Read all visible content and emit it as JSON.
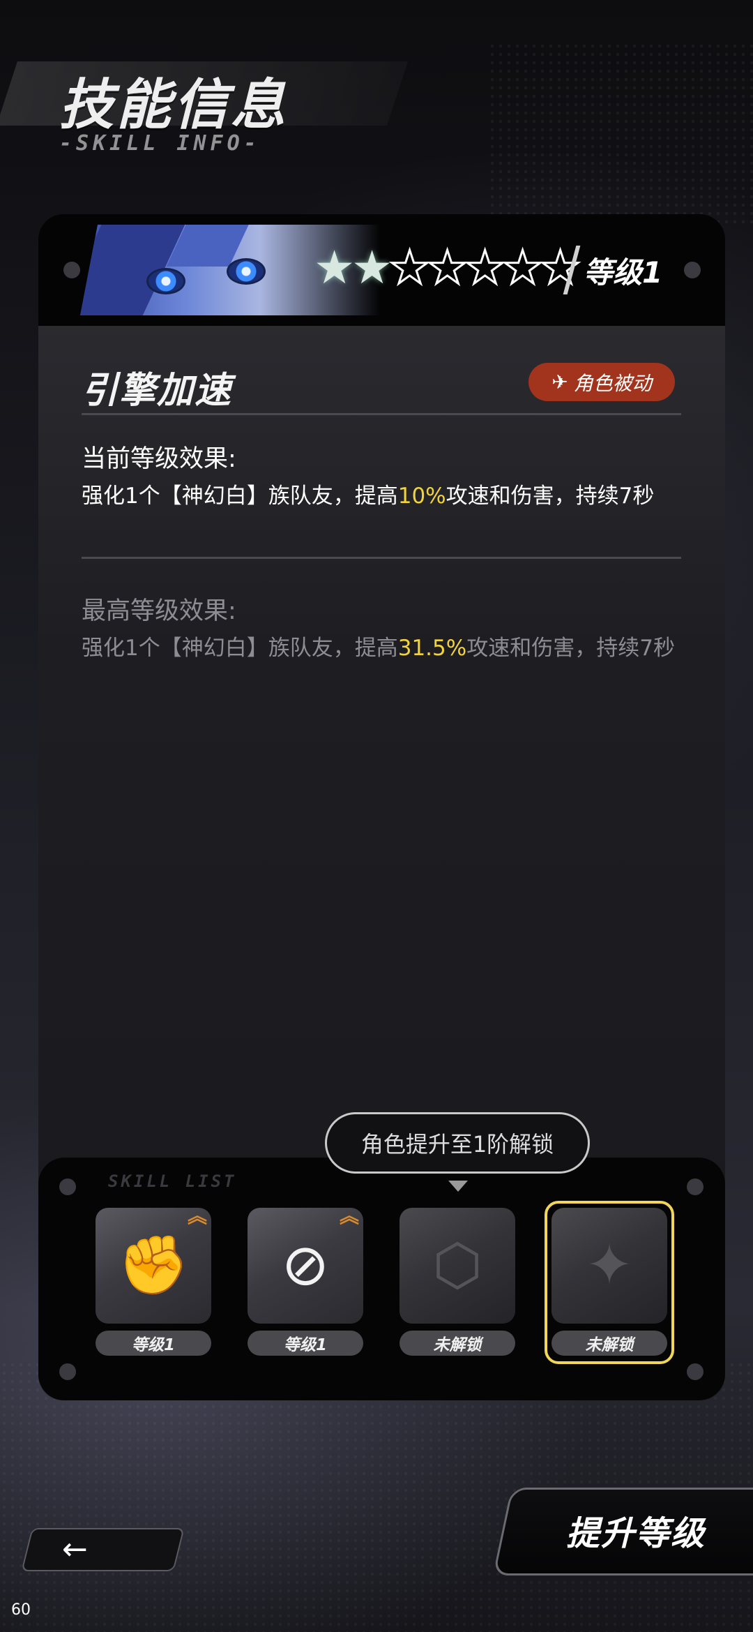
{
  "header": {
    "title": "技能信息",
    "subtitle": "-SKILL INFO-"
  },
  "card": {
    "stars_filled": 2,
    "stars_total": 7,
    "level_label": "等级1",
    "skill_name": "引擎加速",
    "badge_icon": "plane-icon",
    "badge_label": "角色被动",
    "current": {
      "title": "当前等级效果:",
      "text_before": "强化1个【神幻白】族队友，提高",
      "highlight": "10%",
      "text_after": "攻速和伤害，持续7秒"
    },
    "max": {
      "title": "最高等级效果:",
      "text_before": "强化1个【神幻白】族队友，提高",
      "highlight": "31.5%",
      "text_after": "攻速和伤害，持续7秒"
    }
  },
  "tooltip": {
    "text": "角色提升至1阶解锁"
  },
  "skill_list": {
    "label": "SKILL LIST",
    "slots": [
      {
        "icon": "fist-icon",
        "status": "等级1",
        "upgradable": true,
        "locked": false,
        "selected": false
      },
      {
        "icon": "crosshair-blade-icon",
        "status": "等级1",
        "upgradable": true,
        "locked": false,
        "selected": false
      },
      {
        "icon": "cube-emblem-icon",
        "status": "未解锁",
        "upgradable": false,
        "locked": true,
        "selected": false
      },
      {
        "icon": "compass-star-icon",
        "status": "未解锁",
        "upgradable": false,
        "locked": true,
        "selected": true
      }
    ]
  },
  "controls": {
    "back_icon": "arrow-left-icon",
    "upgrade_label": "提升等级"
  },
  "fps": "60",
  "colors": {
    "highlight": "#f2d43a",
    "badge": "#a2331d",
    "selected_frame": "#f1d65a",
    "upgrade_arrow": "#d98a2e"
  }
}
